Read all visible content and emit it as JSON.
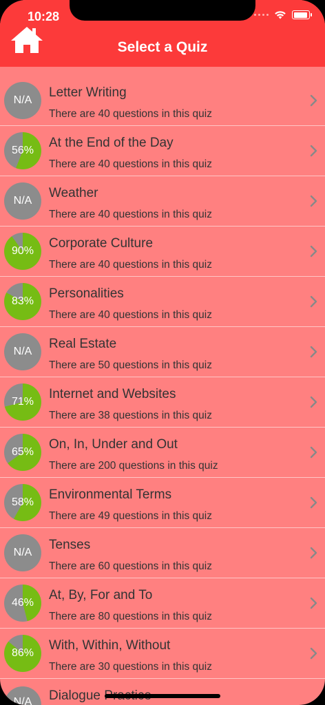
{
  "status_bar": {
    "time": "10:28"
  },
  "header": {
    "title": "Select a Quiz",
    "home_icon": "home-icon"
  },
  "colors": {
    "header": "#fc3a3a",
    "background": "#ff8080",
    "score_fill": "#76bc14",
    "score_empty": "#8c8c8c"
  },
  "quizzes": [
    {
      "badge": "N/A",
      "score": null,
      "title": "Letter Writing",
      "subtitle": "There are 40 questions in this quiz"
    },
    {
      "badge": "56%",
      "score": 56,
      "title": "At the End of the Day",
      "subtitle": "There are 40 questions in this quiz"
    },
    {
      "badge": "N/A",
      "score": null,
      "title": "Weather",
      "subtitle": "There are 40 questions in this quiz"
    },
    {
      "badge": "90%",
      "score": 90,
      "title": "Corporate Culture",
      "subtitle": "There are 40 questions in this quiz"
    },
    {
      "badge": "83%",
      "score": 83,
      "title": "Personalities",
      "subtitle": "There are 40 questions in this quiz"
    },
    {
      "badge": "N/A",
      "score": null,
      "title": "Real Estate",
      "subtitle": "There are 50 questions in this quiz"
    },
    {
      "badge": "71%",
      "score": 71,
      "title": "Internet and Websites",
      "subtitle": "There are 38 questions in this quiz"
    },
    {
      "badge": "65%",
      "score": 65,
      "title": "On, In, Under and Out",
      "subtitle": "There are 200 questions in this quiz"
    },
    {
      "badge": "58%",
      "score": 58,
      "title": "Environmental Terms",
      "subtitle": "There are 49 questions in this quiz"
    },
    {
      "badge": "N/A",
      "score": null,
      "title": "Tenses",
      "subtitle": "There are 60 questions in this quiz"
    },
    {
      "badge": "46%",
      "score": 46,
      "title": "At, By, For and To",
      "subtitle": "There are 80 questions in this quiz"
    },
    {
      "badge": "86%",
      "score": 86,
      "title": "With, Within, Without",
      "subtitle": "There are 30 questions in this quiz"
    }
  ],
  "partial_row": {
    "badge": "N/A",
    "title": "Dialogue Practice"
  }
}
